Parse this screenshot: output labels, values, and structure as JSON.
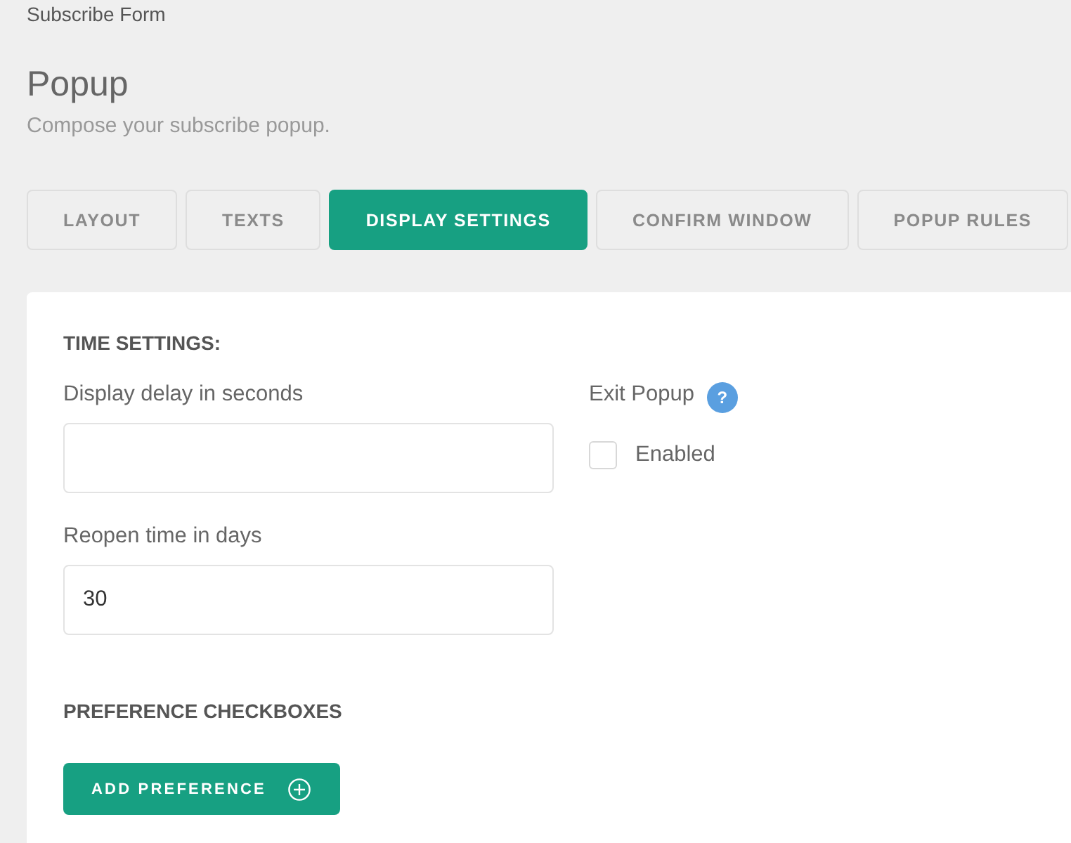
{
  "breadcrumb": "Subscribe Form",
  "header": {
    "title": "Popup",
    "subtitle": "Compose your subscribe popup."
  },
  "tabs": [
    {
      "label": "LAYOUT",
      "selected": false
    },
    {
      "label": "TEXTS",
      "selected": false
    },
    {
      "label": "DISPLAY SETTINGS",
      "selected": true
    },
    {
      "label": "CONFIRM WINDOW",
      "selected": false
    },
    {
      "label": "POPUP RULES",
      "selected": false
    }
  ],
  "time_settings": {
    "heading": "TIME SETTINGS:",
    "fields": [
      {
        "label": "Display delay in seconds"
      },
      {
        "label": "Reopen time in days",
        "value": "30"
      }
    ],
    "exit_popup": {
      "label": "Exit Popup",
      "help": "?",
      "checkbox": {
        "label": "Enabled",
        "checked": false
      }
    }
  },
  "preferences": {
    "heading": "PREFERENCE CHECKBOXES",
    "button": "ADD PREFERENCE"
  }
}
